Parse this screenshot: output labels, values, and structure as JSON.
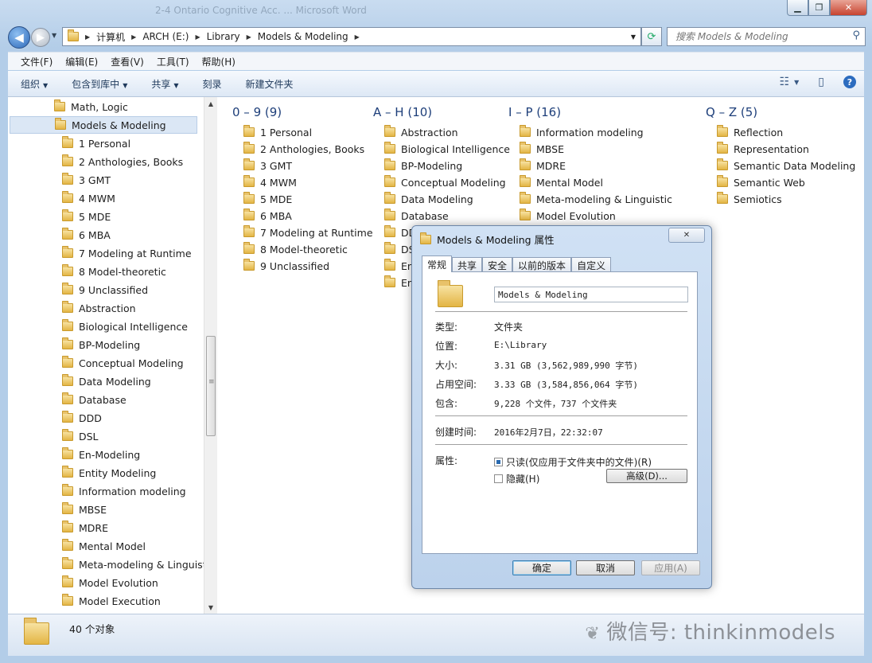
{
  "window": {
    "bg_title": "2-4 Ontario Cognitive Acc. ... Microsoft Word",
    "min": "▁",
    "max": "❐",
    "close": "✕"
  },
  "nav": {
    "back": "◀",
    "forward": "▶",
    "drop": "▼",
    "breadcrumb": [
      "计算机",
      "ARCH (E:)",
      "Library",
      "Models & Modeling"
    ],
    "search_placeholder": "搜索 Models & Modeling"
  },
  "menu": [
    "文件(F)",
    "编辑(E)",
    "查看(V)",
    "工具(T)",
    "帮助(H)"
  ],
  "toolbar": {
    "organize": "组织",
    "include": "包含到库中",
    "share": "共享",
    "burn": "刻录",
    "newfolder": "新建文件夹",
    "arrow": "▼",
    "help": "?"
  },
  "tree": {
    "items": [
      {
        "label": "Math, Logic",
        "level": 0
      },
      {
        "label": "Models & Modeling",
        "level": 0,
        "selected": true
      },
      {
        "label": "1 Personal",
        "level": 1
      },
      {
        "label": "2 Anthologies, Books",
        "level": 1
      },
      {
        "label": "3 GMT",
        "level": 1
      },
      {
        "label": "4 MWM",
        "level": 1
      },
      {
        "label": "5 MDE",
        "level": 1
      },
      {
        "label": "6 MBA",
        "level": 1
      },
      {
        "label": "7 Modeling at Runtime",
        "level": 1
      },
      {
        "label": "8 Model-theoretic",
        "level": 1
      },
      {
        "label": "9 Unclassified",
        "level": 1
      },
      {
        "label": "Abstraction",
        "level": 1
      },
      {
        "label": "Biological Intelligence",
        "level": 1
      },
      {
        "label": "BP-Modeling",
        "level": 1
      },
      {
        "label": "Conceptual Modeling",
        "level": 1
      },
      {
        "label": "Data Modeling",
        "level": 1
      },
      {
        "label": "Database",
        "level": 1
      },
      {
        "label": "DDD",
        "level": 1
      },
      {
        "label": "DSL",
        "level": 1
      },
      {
        "label": "En-Modeling",
        "level": 1
      },
      {
        "label": "Entity Modeling",
        "level": 1
      },
      {
        "label": "Information modeling",
        "level": 1
      },
      {
        "label": "MBSE",
        "level": 1
      },
      {
        "label": "MDRE",
        "level": 1
      },
      {
        "label": "Mental Model",
        "level": 1
      },
      {
        "label": "Meta-modeling & Linguist",
        "level": 1
      },
      {
        "label": "Model Evolution",
        "level": 1
      },
      {
        "label": "Model Execution",
        "level": 1
      }
    ]
  },
  "groups": [
    {
      "header": "0 – 9 (9)",
      "items": [
        "1 Personal",
        "2 Anthologies, Books",
        "3 GMT",
        "4 MWM",
        "5 MDE",
        "6 MBA",
        "7 Modeling at Runtime",
        "8 Model-theoretic",
        "9 Unclassified"
      ]
    },
    {
      "header": "A – H (10)",
      "items": [
        "Abstraction",
        "Biological Intelligence",
        "BP-Modeling",
        "Conceptual Modeling",
        "Data Modeling",
        "Database",
        "DDD",
        "DSL",
        "En-Modeling",
        "Entity Modeling"
      ]
    },
    {
      "header": "I – P (16)",
      "items": [
        "Information modeling",
        "MBSE",
        "MDRE",
        "Mental Model",
        "Meta-modeling & Linguistic",
        "Model Evolution"
      ]
    },
    {
      "header": "Q – Z (5)",
      "items": [
        "Reflection",
        "Representation",
        "Semantic Data Modeling",
        "Semantic Web",
        "Semiotics"
      ]
    }
  ],
  "status": {
    "count": "40 个对象",
    "watermark": "微信号: thinkinmodels"
  },
  "dialog": {
    "title": "Models & Modeling 属性",
    "close": "✕",
    "tabs": [
      "常规",
      "共享",
      "安全",
      "以前的版本",
      "自定义"
    ],
    "name": "Models & Modeling",
    "type_label": "类型:",
    "type": "文件夹",
    "location_label": "位置:",
    "location": "E:\\Library",
    "size_label": "大小:",
    "size": "3.31 GB (3,562,989,990 字节)",
    "disk_label": "占用空间:",
    "disk": "3.33 GB (3,584,856,064 字节)",
    "contains_label": "包含:",
    "contains": "9,228 个文件，737 个文件夹",
    "created_label": "创建时间:",
    "created": "2016年2月7日，22:32:07",
    "attr_label": "属性:",
    "readonly": "只读(仅应用于文件夹中的文件)(R)",
    "hidden": "隐藏(H)",
    "advanced": "高级(D)...",
    "ok": "确定",
    "cancel": "取消",
    "apply": "应用(A)"
  }
}
